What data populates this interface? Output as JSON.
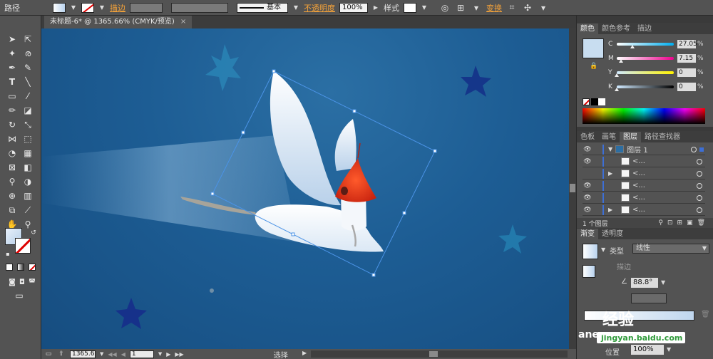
{
  "control_bar": {
    "label_path": "路径",
    "label_stroke": "描边",
    "stroke_profile": "基本",
    "label_opacity": "不透明度",
    "opacity_value": "100%",
    "label_style": "样式",
    "label_transform": "变换"
  },
  "document": {
    "tab_title": "未标题-6* @ 1365.66% (CMYK/预览)",
    "close_glyph": "×"
  },
  "status_bar": {
    "zoom": "1365.6",
    "page": "1",
    "mode": "选择"
  },
  "color_panel": {
    "tabs": [
      "颜色",
      "颜色参考",
      "描边"
    ],
    "channels": [
      {
        "name": "C",
        "value": "27.05",
        "unit": "%",
        "level": 0.27
      },
      {
        "name": "M",
        "value": "7.15",
        "unit": "%",
        "level": 0.07
      },
      {
        "name": "Y",
        "value": "0",
        "unit": "%",
        "level": 0
      },
      {
        "name": "K",
        "value": "0",
        "unit": "%",
        "level": 0
      }
    ],
    "fill_color": "#c8ddf0"
  },
  "layers_panel": {
    "tabs": [
      "色板",
      "画笔",
      "图层",
      "路径查找器"
    ],
    "layer_name": "图层 1",
    "sublayer_glyph": "<...",
    "count_label": "1 个图层"
  },
  "gradient_panel": {
    "tabs": [
      "渐变",
      "透明度"
    ],
    "type_label": "类型",
    "type_value": "线性",
    "stroke_label": "描边",
    "angle_value": "88.8°",
    "position_label": "位置",
    "position_value": "100%"
  },
  "watermark": {
    "text1": "经验",
    "text2": "jingyan.baidu.com",
    "text3": "ane"
  }
}
